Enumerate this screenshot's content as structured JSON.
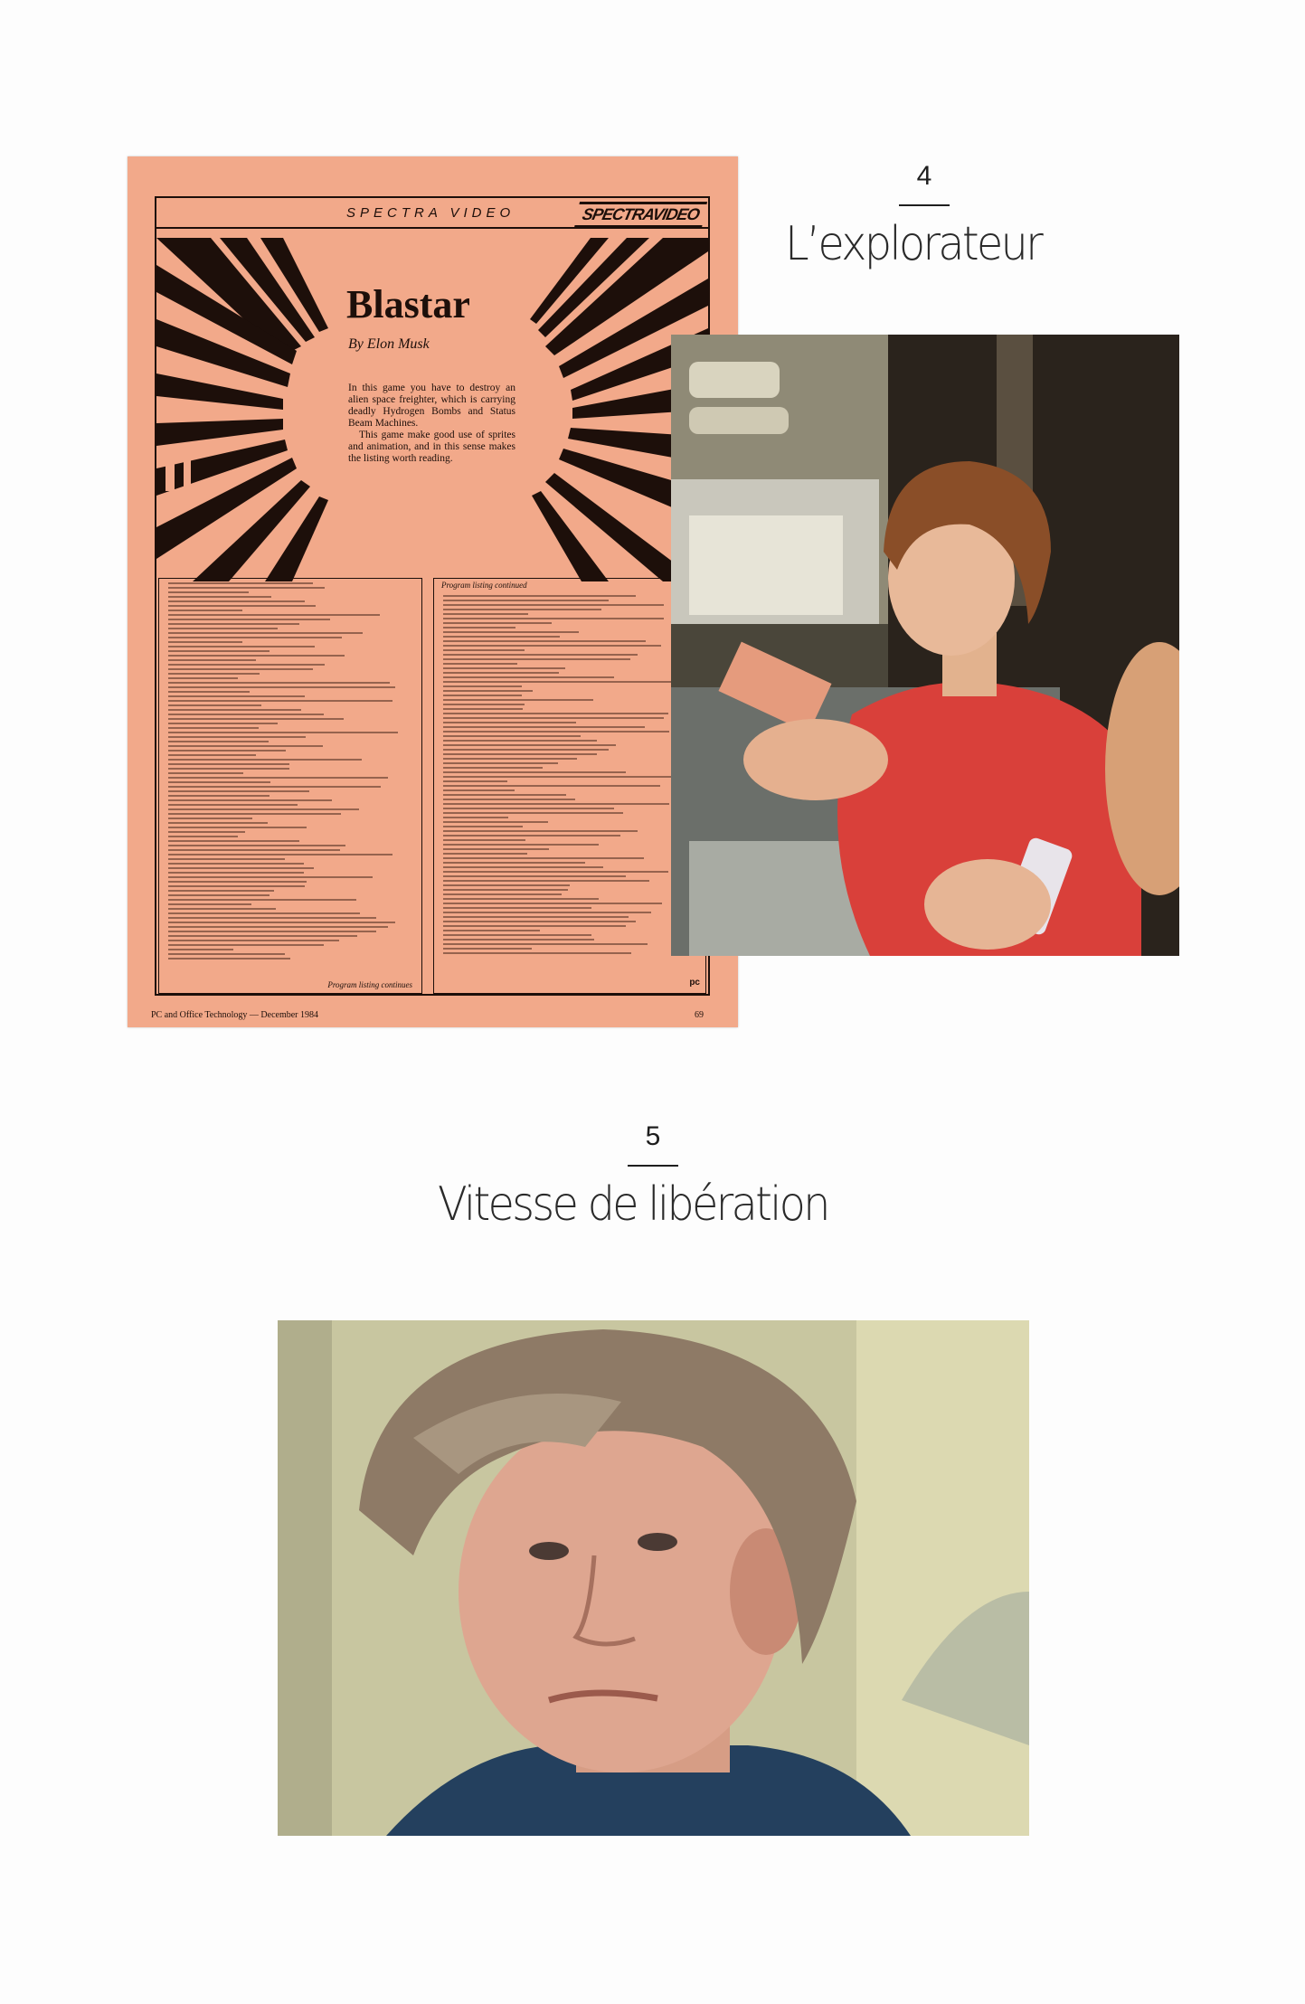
{
  "magazine": {
    "header_label": "SPECTRA VIDEO",
    "logo_text": "SPECTRAVIDEO",
    "title": "Blastar",
    "byline": "By Elon Musk",
    "intro_p1": "In this game you have to destroy an alien space freighter, which is carrying deadly Hydrogen Bombs and Status Beam Machines.",
    "intro_p2": "This game make good use of sprites and animation, and in this sense makes the listing worth reading.",
    "listing_continued_head": "Program listing continued",
    "listing_continues_foot": "Program listing continues",
    "pc_mark": "pc",
    "footer_left": "PC and Office Technology — December 1984",
    "footer_page": "69"
  },
  "sections": [
    {
      "number": "4",
      "title": "L’explorateur"
    },
    {
      "number": "5",
      "title": "Vitesse de libération"
    }
  ]
}
